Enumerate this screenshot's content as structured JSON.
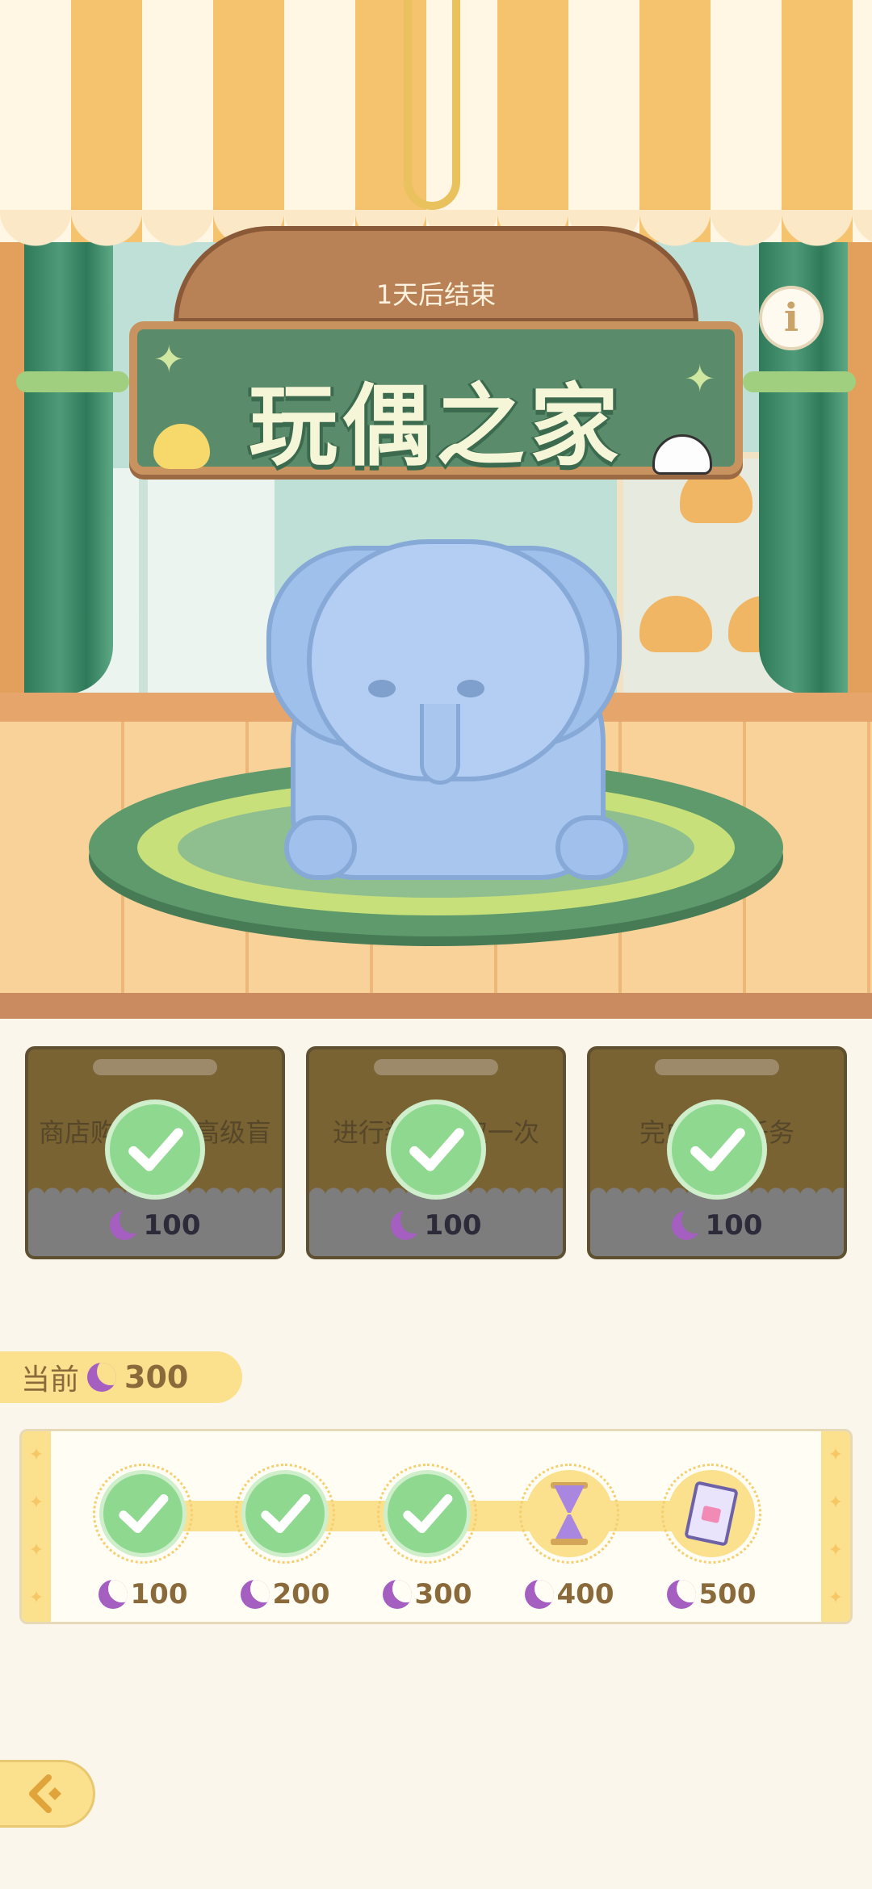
{
  "event": {
    "time_left": "1天后结束",
    "title": "玩偶之家"
  },
  "tasks": [
    {
      "description": "商店购买一次高级盲盒礼券",
      "reward": "100",
      "completed": true
    },
    {
      "description": "进行装扮领取一次",
      "reward": "100",
      "completed": true
    },
    {
      "description": "完成每日任务",
      "reward": "100",
      "completed": true
    }
  ],
  "progress": {
    "current_label": "当前",
    "current_value": "300",
    "milestones": [
      {
        "value": "100",
        "claimed": true
      },
      {
        "value": "200",
        "claimed": true
      },
      {
        "value": "300",
        "claimed": true
      },
      {
        "value": "400",
        "claimed": false,
        "reward_icon": "hourglass-icon"
      },
      {
        "value": "500",
        "claimed": false,
        "reward_icon": "ticket-icon"
      }
    ]
  },
  "colors": {
    "accent_yellow": "#fbe08e",
    "check_green": "#8fd88f",
    "moon_purple": "#a45fc0",
    "sign_green": "#5a8c6c"
  }
}
